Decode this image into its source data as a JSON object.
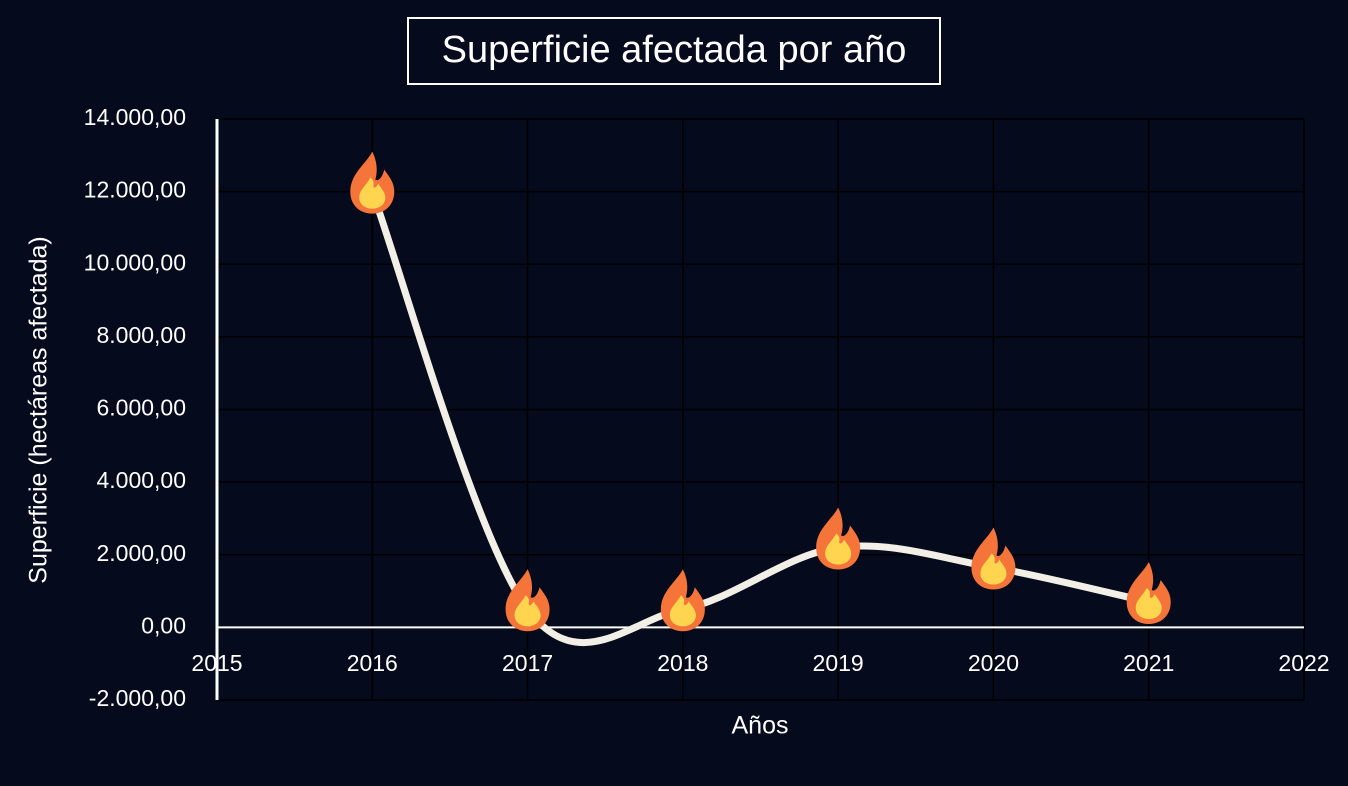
{
  "chart_data": {
    "type": "line",
    "title": "Superficie afectada por año",
    "xlabel": "Años",
    "ylabel": "Superficie (hectáreas afectada)",
    "xlim": [
      2015,
      2022
    ],
    "ylim": [
      -2000,
      14000
    ],
    "x_ticks": [
      2015,
      2016,
      2017,
      2018,
      2019,
      2020,
      2021,
      2022
    ],
    "x_tick_labels": [
      "2015",
      "2016",
      "2017",
      "2018",
      "2019",
      "2020",
      "2021",
      "2022"
    ],
    "y_ticks": [
      -2000,
      0,
      2000,
      4000,
      6000,
      8000,
      10000,
      12000,
      14000
    ],
    "y_tick_labels": [
      "-2.000,00",
      "0,00",
      "2.000,00",
      "4.000,00",
      "6.000,00",
      "8.000,00",
      "10.000,00",
      "12.000,00",
      "14.000,00"
    ],
    "grid": true,
    "smoothed": true,
    "marker_icon": "fire-icon",
    "series": [
      {
        "x": [
          2016,
          2017,
          2018,
          2019,
          2020,
          2021
        ],
        "y": [
          12000,
          500,
          500,
          2200,
          1650,
          700
        ]
      }
    ],
    "colors": {
      "background": "#050a1c",
      "line": "#f1efe6",
      "grid": "#000000",
      "text": "#ffffff",
      "flame_outer": "#f5743a",
      "flame_inner": "#ffd54f"
    }
  }
}
